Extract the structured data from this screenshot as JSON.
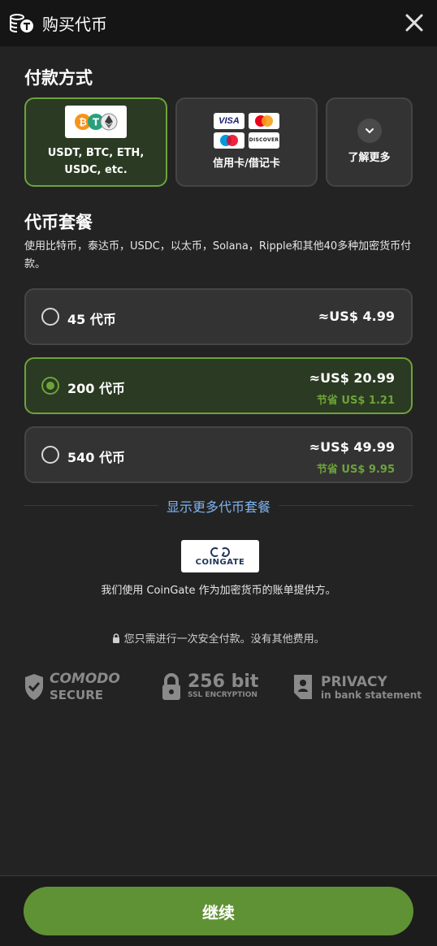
{
  "header": {
    "title": "购买代币",
    "logo_icon": "coins-icon",
    "close_icon": "close-icon"
  },
  "payment": {
    "title": "付款方式",
    "options": [
      {
        "label_line1": "USDT, BTC, ETH,",
        "label_line2": "USDC, etc.",
        "selected": true
      },
      {
        "label": "信用卡/借记卡",
        "visa": "VISA",
        "discover": "DISCOVER",
        "selected": false
      },
      {
        "label": "了解更多",
        "selected": false
      }
    ]
  },
  "packages": {
    "title": "代币套餐",
    "description": "使用比特币，泰达币，USDC，以太币，Solana，Ripple和其他40多种加密货币付款。",
    "items": [
      {
        "name": "45 代币",
        "price": "≈US$ 4.99",
        "saving": "",
        "selected": false
      },
      {
        "name": "200 代币",
        "price": "≈US$ 20.99",
        "saving": "节省 US$ 1.21",
        "selected": true
      },
      {
        "name": "540 代币",
        "price": "≈US$ 49.99",
        "saving": "节省 US$ 9.95",
        "selected": false
      }
    ],
    "more_link": "显示更多代币套餐"
  },
  "provider": {
    "logo_text": "COINGATE",
    "text": "我们使用 CoinGate 作为加密货币的账单提供方。"
  },
  "secure_note": "您只需进行一次安全付款。没有其他费用。",
  "badges": {
    "comodo": {
      "line1": "COMODO",
      "line2": "SECURE"
    },
    "ssl": {
      "line1": "256 bit",
      "line2": "SSL ENCRYPTION"
    },
    "privacy": {
      "line1": "PRIVACY",
      "line2": "in bank statement"
    }
  },
  "continue_button": "继续",
  "colors": {
    "accent": "#6da33a",
    "button": "#5f9234",
    "link": "#7fb3ef",
    "background": "#232323"
  }
}
